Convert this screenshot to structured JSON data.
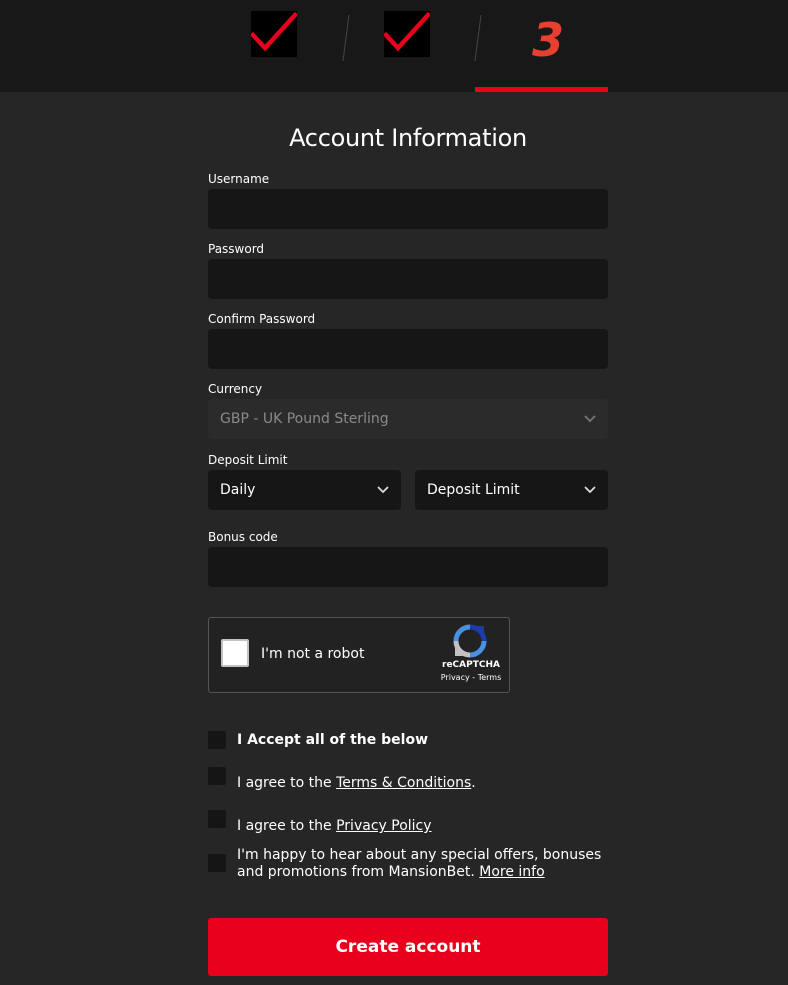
{
  "steps": {
    "step1_icon": "checkmark-icon",
    "step2_icon": "checkmark-icon",
    "step3_number": "3",
    "accent_color": "#e8001c"
  },
  "form": {
    "title": "Account Information",
    "username_label": "Username",
    "username_value": "",
    "password_label": "Password",
    "password_value": "",
    "confirm_password_label": "Confirm Password",
    "confirm_password_value": "",
    "currency_label": "Currency",
    "currency_value": "GBP - UK Pound Sterling",
    "deposit_limit_label": "Deposit Limit",
    "deposit_period_value": "Daily",
    "deposit_amount_value": "Deposit Limit",
    "bonus_code_label": "Bonus code",
    "bonus_code_value": ""
  },
  "captcha": {
    "label": "I'm not a robot",
    "brand": "reCAPTCHA",
    "links": "Privacy - Terms"
  },
  "consents": {
    "accept_all": "I Accept all of the below",
    "terms_prefix": "I agree to the ",
    "terms_link": "Terms & Conditions",
    "terms_suffix": ".",
    "privacy_prefix": "I agree to the ",
    "privacy_link": "Privacy Policy",
    "offers_text": "I'm happy to hear about any special offers, bonuses and promotions from MansionBet.",
    "offers_link": "More info"
  },
  "submit_label": "Create account"
}
